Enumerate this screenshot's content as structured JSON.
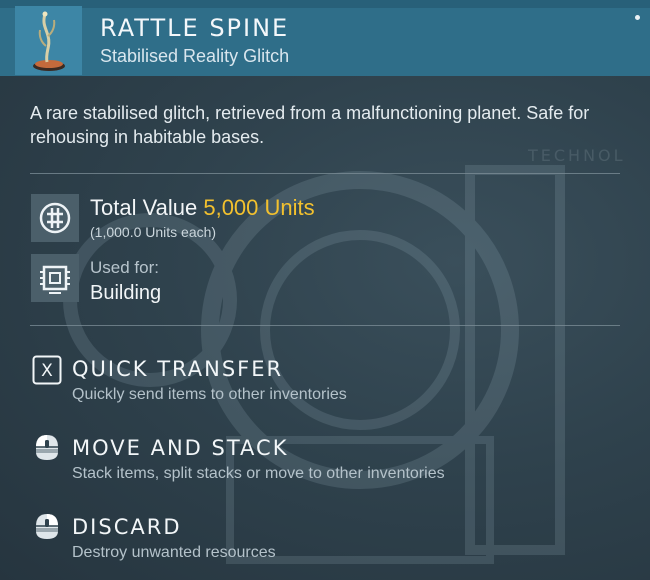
{
  "item": {
    "name": "RATTLE SPINE",
    "subtitle": "Stabilised Reality Glitch",
    "description": "A rare stabilised glitch, retrieved from a malfunctioning planet. Safe for rehousing in habitable bases."
  },
  "value": {
    "label": "Total Value",
    "amount": "5,000 Units",
    "each": "(1,000.0 Units each)",
    "icon": "units-currency-icon"
  },
  "usage": {
    "label": "Used for:",
    "value": "Building",
    "icon": "building-module-icon"
  },
  "actions": [
    {
      "key": "X",
      "title": "QUICK TRANSFER",
      "description": "Quickly send items to other inventories",
      "icon": "x-key-icon"
    },
    {
      "title": "MOVE AND STACK",
      "description": "Stack items, split stacks or move to other inventories",
      "icon": "mouse-left-click-icon"
    },
    {
      "title": "DISCARD",
      "description": "Destroy unwanted resources",
      "icon": "mouse-right-click-icon"
    }
  ],
  "background_watermark": "TECHNOL",
  "colors": {
    "header": "#2f6e89",
    "accent_value": "#f3c12e",
    "panel": "#2f424d"
  }
}
